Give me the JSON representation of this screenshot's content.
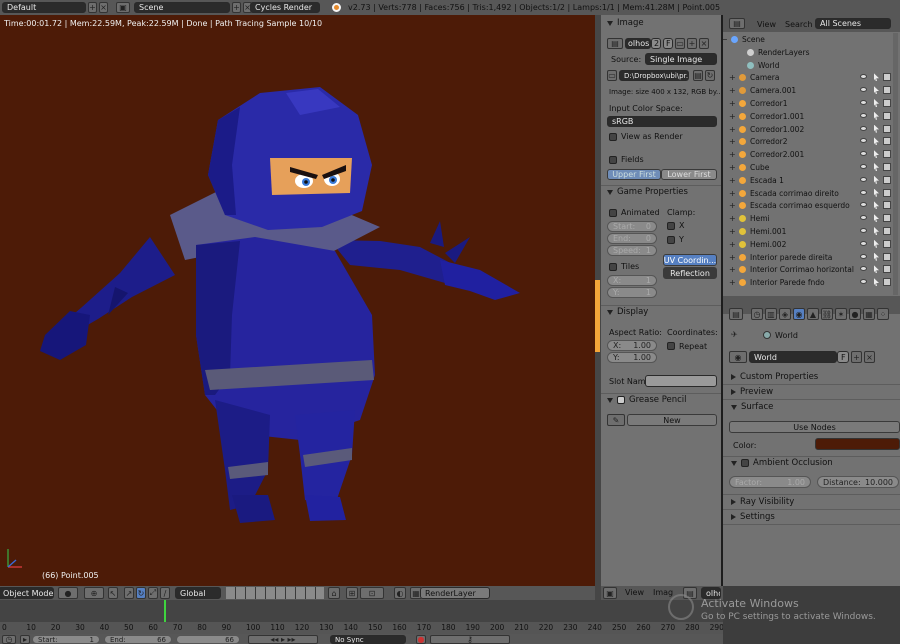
{
  "top": {
    "screen_layout": "Default",
    "scene": "Scene",
    "render_engine": "Cycles Render",
    "stats": "v2.73 | Verts:778 | Faces:756 | Tris:1,492 | Objects:1/2 | Lamps:1/1 | Mem:41.28M | Point.005"
  },
  "viewport": {
    "render_info": "Time:00:01.72 | Mem:22.59M, Peak:22.59M | Done | Path Tracing Sample 10/10",
    "object_label": "(66) Point.005",
    "bg_color": "#4d1b07"
  },
  "view3d_header": {
    "mode": "Object Mode",
    "orientation": "Global",
    "render_layer": "RenderLayer"
  },
  "image_panel": {
    "title": "Image",
    "image_name": "olhos.",
    "users": "2",
    "fake_user": "F",
    "source_label": "Source:",
    "source_value": "Single Image",
    "filepath": "D:\\Dropbox\\ubi\\pr...",
    "info": "Image: size 400 x 132, RGB by...",
    "color_space_label": "Input Color Space:",
    "color_space": "sRGB",
    "view_as_render": "View as Render",
    "fields": "Fields",
    "upper_first": "Upper First",
    "lower_first": "Lower First"
  },
  "game_props": {
    "title": "Game Properties",
    "animated": "Animated",
    "clamp": "Clamp:",
    "start": "Start:",
    "start_val": "0",
    "end": "End:",
    "end_val": "0",
    "speed": "Speed:",
    "speed_val": "1",
    "x": "X",
    "y": "Y",
    "tiles": "Tiles",
    "tx": "X:",
    "tx_val": "1",
    "ty": "Y:",
    "ty_val": "1",
    "uv": "UV Coordin...",
    "reflection": "Reflection"
  },
  "display": {
    "title": "Display",
    "aspect": "Aspect Ratio:",
    "coords": "Coordinates:",
    "ax": "X:",
    "ax_val": "1.00",
    "ay": "Y:",
    "ay_val": "1.00",
    "repeat": "Repeat",
    "slot": "Slot Nam"
  },
  "grease": {
    "title": "Grease Pencil",
    "new": "New"
  },
  "image_editor_header": {
    "view": "View",
    "image": "Imag",
    "name": "olhos"
  },
  "outliner": {
    "view": "View",
    "search": "Search",
    "scenes": "All Scenes",
    "items": [
      {
        "name": "Scene",
        "type": "scene"
      },
      {
        "name": "RenderLayers",
        "type": "layer"
      },
      {
        "name": "World",
        "type": "world"
      },
      {
        "name": "Camera",
        "type": "camera"
      },
      {
        "name": "Camera.001",
        "type": "camera"
      },
      {
        "name": "Corredor1",
        "type": "mesh"
      },
      {
        "name": "Corredor1.001",
        "type": "mesh"
      },
      {
        "name": "Corredor1.002",
        "type": "mesh"
      },
      {
        "name": "Corredor2",
        "type": "mesh"
      },
      {
        "name": "Corredor2.001",
        "type": "mesh"
      },
      {
        "name": "Cube",
        "type": "mesh"
      },
      {
        "name": "Escada 1",
        "type": "mesh"
      },
      {
        "name": "Escada corrimao direito",
        "type": "mesh"
      },
      {
        "name": "Escada corrimao esquerdo",
        "type": "mesh"
      },
      {
        "name": "Hemi",
        "type": "lamp"
      },
      {
        "name": "Hemi.001",
        "type": "lamp"
      },
      {
        "name": "Hemi.002",
        "type": "lamp"
      },
      {
        "name": "Interior parede direita",
        "type": "mesh"
      },
      {
        "name": "Interior Corrimao horizontal",
        "type": "mesh"
      },
      {
        "name": "Interior Parede fndo",
        "type": "mesh"
      }
    ]
  },
  "world": {
    "breadcrumb": "World",
    "name": "World",
    "fake": "F",
    "custom_props": "Custom Properties",
    "preview": "Preview",
    "surface": "Surface",
    "use_nodes": "Use Nodes",
    "color_label": "Color:",
    "color": "#4d1b07",
    "ao": "Ambient Occlusion",
    "factor": "Factor:",
    "factor_val": "1.00",
    "distance": "Distance:",
    "distance_val": "10.000",
    "ray_vis": "Ray Visibility",
    "settings": "Settings"
  },
  "timeline": {
    "ticks": [
      "0",
      "10",
      "20",
      "30",
      "40",
      "50",
      "60",
      "70",
      "80",
      "90",
      "100",
      "110",
      "120",
      "130",
      "140",
      "150",
      "160",
      "170",
      "180",
      "190",
      "200",
      "210",
      "220",
      "230",
      "240",
      "250",
      "260",
      "270",
      "280",
      "290"
    ],
    "start": "Start:",
    "start_val": "1",
    "end": "End:",
    "end_val": "66",
    "nosync": "No Sync"
  },
  "watermark": {
    "title": "Activate Windows",
    "sub": "Go to PC settings to activate Windows."
  }
}
